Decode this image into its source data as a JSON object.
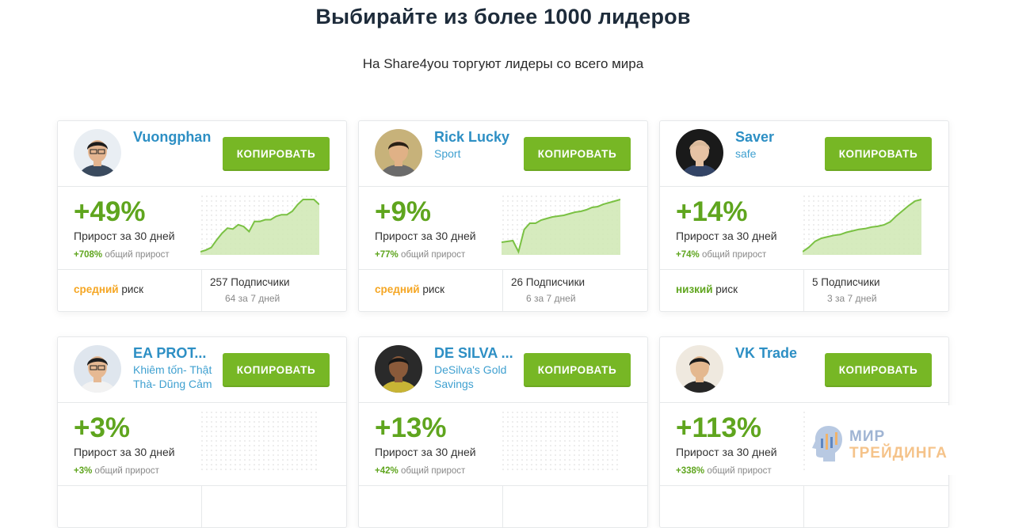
{
  "header": {
    "title": "Выбирайте из более 1000 лидеров",
    "subtitle": "На Share4you торгуют лидеры со всего мира"
  },
  "colors": {
    "accent_green": "#77b725",
    "link_blue": "#2d8fc4",
    "risk_medium": "#f5a623",
    "risk_low": "#5fa51e"
  },
  "common": {
    "copy_label": "КОПИРОВАТЬ",
    "growth_label": "Прирост за 30 дней",
    "total_suffix": "общий прирост",
    "risk_word": "риск"
  },
  "leaders": [
    {
      "name": "Vuongphan",
      "strategy": "",
      "growth": "+49%",
      "total": "+708%",
      "risk": "средний",
      "subscribers": "257 Подписчики",
      "week": "64 за 7 дней",
      "sparkline": [
        0,
        2,
        5,
        14,
        22,
        28,
        27,
        32,
        30,
        24,
        36,
        36,
        38,
        38,
        42,
        44,
        44,
        48,
        56,
        62,
        62,
        62,
        56
      ]
    },
    {
      "name": "Rick Lucky",
      "strategy": "Sport",
      "growth": "+9%",
      "total": "+77%",
      "risk": "средний",
      "subscribers": "26 Подписчики",
      "week": "6 за 7 дней",
      "sparkline": [
        14,
        15,
        16,
        2,
        30,
        38,
        38,
        42,
        44,
        46,
        47,
        48,
        50,
        52,
        53,
        55,
        58,
        59,
        62,
        64,
        66,
        68
      ]
    },
    {
      "name": "Saver",
      "strategy": "safe",
      "growth": "+14%",
      "total": "+74%",
      "risk": "низкий",
      "subscribers": "5 Подписчики",
      "week": "3 за 7 дней",
      "sparkline": [
        0,
        6,
        14,
        18,
        20,
        22,
        23,
        26,
        28,
        30,
        31,
        33,
        34,
        36,
        40,
        48,
        55,
        62,
        68,
        70
      ]
    },
    {
      "name": "EA PROT...",
      "strategy": "Khiêm tốn- Thật Thà- Dũng Cảm",
      "growth": "+3%",
      "total": "+3%",
      "risk": "",
      "subscribers": "",
      "week": "",
      "sparkline": []
    },
    {
      "name": "DE SILVA ...",
      "strategy": "DeSilva's Gold Savings",
      "growth": "+13%",
      "total": "+42%",
      "risk": "",
      "subscribers": "",
      "week": "",
      "sparkline": []
    },
    {
      "name": "VK Trade",
      "strategy": "",
      "growth": "+113%",
      "total": "+338%",
      "risk": "",
      "subscribers": "",
      "week": "",
      "sparkline": []
    }
  ],
  "watermark": {
    "line1": "МИР",
    "line2": "ТРЕЙДИНГА"
  }
}
